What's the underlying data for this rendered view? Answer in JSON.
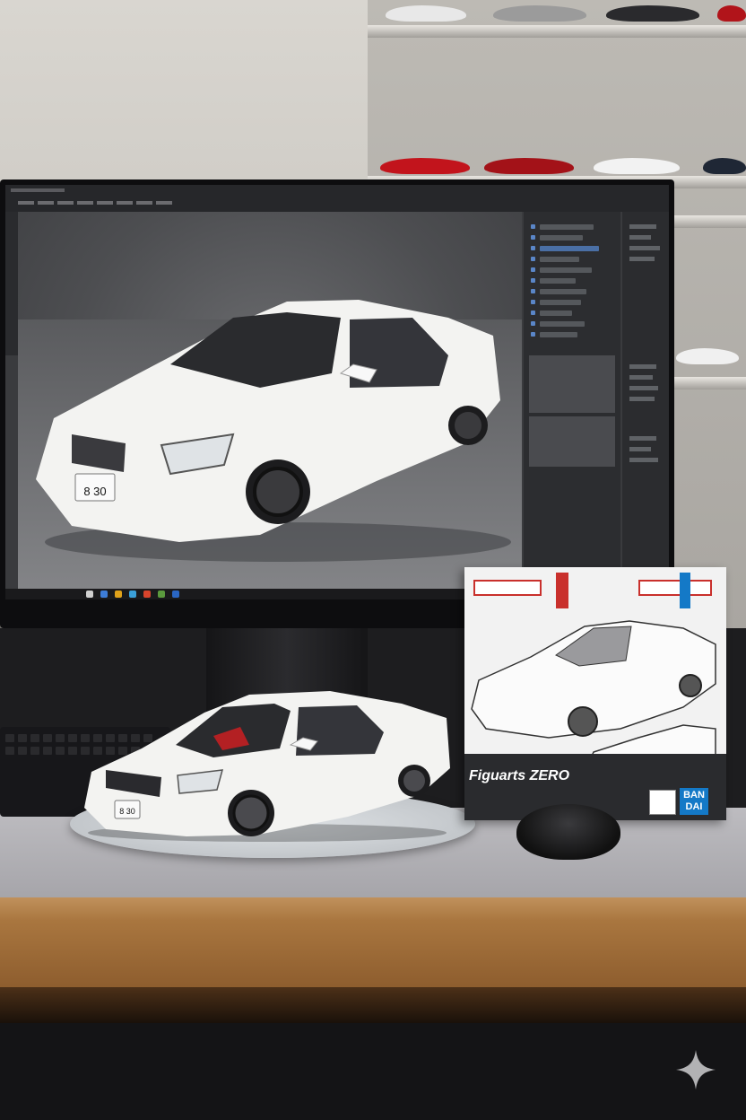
{
  "scene": {
    "description_elements": [
      "monitor",
      "model-car",
      "product-box",
      "mouse",
      "shelf"
    ]
  },
  "monitor": {
    "plate_text": "8 30"
  },
  "model": {
    "plate_text": "8 30"
  },
  "box": {
    "tag_left": "",
    "tag_right": "",
    "title": "Figuarts ZERO",
    "brand_line1": "BAN",
    "brand_line2": "DAI"
  },
  "colors": {
    "car_white": "#f3f3f1",
    "wheel": "#2a2a2c",
    "desk": "#a9763f",
    "box_red": "#c9302c",
    "bandai_blue": "#1479c7"
  }
}
